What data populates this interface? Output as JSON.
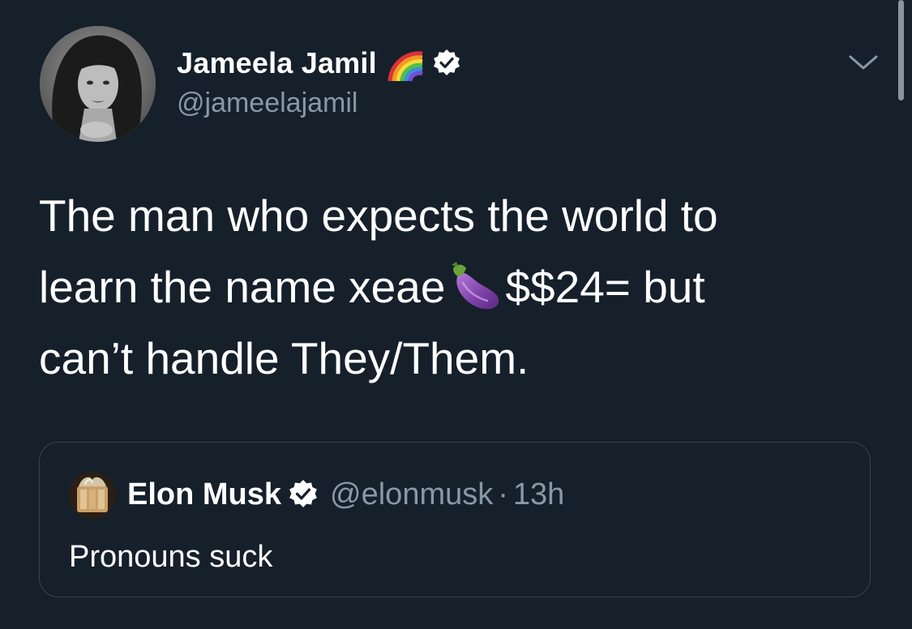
{
  "author": {
    "display_name": "Jameela Jamil",
    "handle": "@jameelajamil",
    "name_emoji": "rainbow-icon",
    "verified": true
  },
  "menu": {
    "caret_icon": "chevron-down-icon"
  },
  "tweet": {
    "lines": [
      "The man who expects the world to",
      "learn the name xeae",
      "$$24= but",
      "can’t handle They/Them."
    ],
    "inline_emoji": "eggplant-icon"
  },
  "quoted_tweet": {
    "display_name": "Elon Musk",
    "verified": true,
    "handle": "@elonmusk",
    "separator": "·",
    "time": "13h",
    "text": "Pronouns suck"
  },
  "colors": {
    "background": "#15202b",
    "secondary_text": "#8899a6",
    "border": "#38444d",
    "verified_badge": "#ffffff"
  }
}
